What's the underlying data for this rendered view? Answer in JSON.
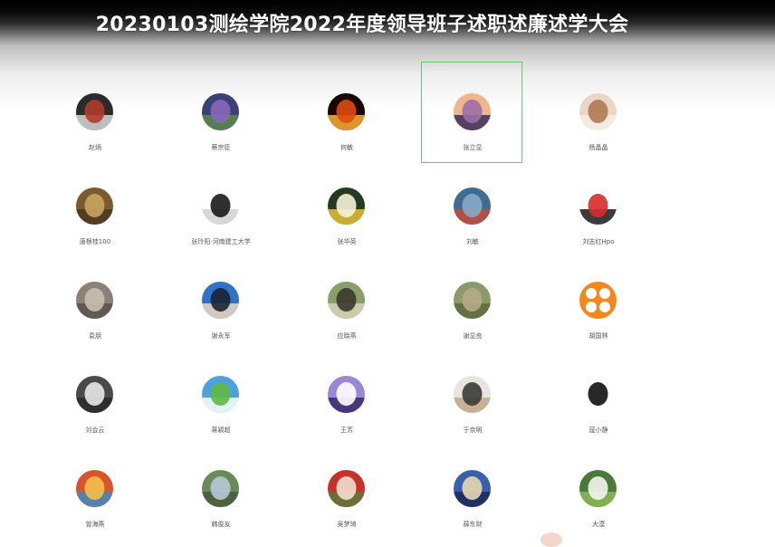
{
  "meeting": {
    "title": "20230103测绘学院2022年度领导班子述职述廉述学大会"
  },
  "participants": [
    {
      "name": "赵炳",
      "avatar": "portrait-dark-red",
      "colors": [
        "#2b2b2b",
        "#b03a2e",
        "#d8d8d8"
      ]
    },
    {
      "name": "蔡宗臣",
      "avatar": "flowers-purple",
      "colors": [
        "#3b3f7a",
        "#8a67b8",
        "#5d8a4c"
      ]
    },
    {
      "name": "何敏",
      "avatar": "fire-dark",
      "colors": [
        "#1a0500",
        "#e04a10",
        "#ffb030"
      ]
    },
    {
      "name": "张立显",
      "avatar": "sunset-landscape",
      "colors": [
        "#f1b58a",
        "#9b6fa8",
        "#3b2d5a"
      ],
      "selected": true
    },
    {
      "name": "杨晶晶",
      "avatar": "girl-photo",
      "colors": [
        "#e9d7c4",
        "#b07a56",
        "#f5efe8"
      ]
    },
    {
      "name": "唐根桂100",
      "avatar": "bird-brown",
      "colors": [
        "#7b5a2f",
        "#caa35f",
        "#4a3a20"
      ]
    },
    {
      "name": "张玲阳·河南建工大学",
      "avatar": "suit-figure",
      "colors": [
        "#ffffff",
        "#1a1a1a",
        "#d0d0d0"
      ]
    },
    {
      "name": "张华英",
      "avatar": "daffodils",
      "colors": [
        "#233b1f",
        "#f6f2d9",
        "#e8c13a"
      ]
    },
    {
      "name": "刘敏",
      "avatar": "city-blue",
      "colors": [
        "#3d6d92",
        "#89a9c4",
        "#c84a3b"
      ]
    },
    {
      "name": "刘志红Hpo",
      "avatar": "red-mascot",
      "colors": [
        "#ffffff",
        "#d72a2a",
        "#1a1a1a"
      ]
    },
    {
      "name": "袁朋",
      "avatar": "rock-gray",
      "colors": [
        "#8a8178",
        "#c9bfb0",
        "#5a524b"
      ]
    },
    {
      "name": "谢永军",
      "avatar": "man-blue",
      "colors": [
        "#2f73c9",
        "#1b2433",
        "#f0d7c0"
      ]
    },
    {
      "name": "应晓燕",
      "avatar": "girl-outdoor",
      "colors": [
        "#8aa06a",
        "#3a3a2a",
        "#d9d1b8"
      ]
    },
    {
      "name": "谢显良",
      "avatar": "tree-field",
      "colors": [
        "#8a9a6a",
        "#b8a88a",
        "#5a6a3a"
      ]
    },
    {
      "name": "胡国林",
      "avatar": "orange-app",
      "colors": [
        "#f5871f",
        "#ffffff",
        "#f5871f"
      ]
    },
    {
      "name": "刘会云",
      "avatar": "cat-gray",
      "colors": [
        "#4a4a4a",
        "#e8e8e8",
        "#2a2a2a"
      ]
    },
    {
      "name": "蒋颖超",
      "avatar": "green-field",
      "colors": [
        "#4fa0e0",
        "#5fb840",
        "#ffffff"
      ]
    },
    {
      "name": "王芳",
      "avatar": "cartoon-purple",
      "colors": [
        "#9a87d6",
        "#ffffff",
        "#3a2a6a"
      ]
    },
    {
      "name": "于京明",
      "avatar": "child-writing",
      "colors": [
        "#e8e4de",
        "#3a3a3a",
        "#c0a888"
      ]
    },
    {
      "name": "寇小静",
      "avatar": "silhouette-black",
      "colors": [
        "#ffffff",
        "#111111",
        "#ffffff"
      ]
    },
    {
      "name": "曾海燕",
      "avatar": "colorful-town",
      "colors": [
        "#d8542f",
        "#f2c04a",
        "#3f8ac4"
      ]
    },
    {
      "name": "韩俊友",
      "avatar": "mountain-green",
      "colors": [
        "#6b8a5a",
        "#b8c8d8",
        "#4a5a3a"
      ]
    },
    {
      "name": "吴梦琦",
      "avatar": "red-flowers",
      "colors": [
        "#c8302a",
        "#f0e0d0",
        "#5a7a3a"
      ]
    },
    {
      "name": "薛东财",
      "avatar": "temple-blue",
      "colors": [
        "#3a5fb0",
        "#e8d8b0",
        "#1a2a5a"
      ]
    },
    {
      "name": "大漠",
      "avatar": "lily-white",
      "colors": [
        "#4a7a3a",
        "#f5f5f0",
        "#8ab85a"
      ]
    }
  ]
}
